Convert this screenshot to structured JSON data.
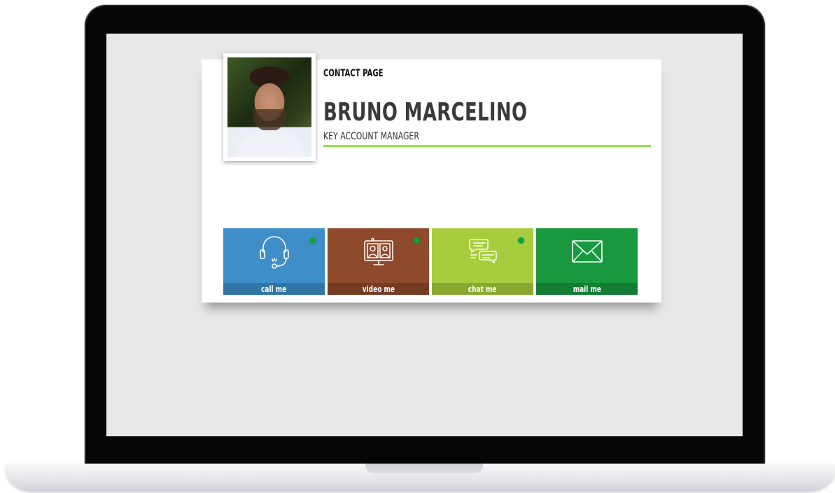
{
  "page": {
    "kicker": "CONTACT PAGE",
    "name": "BRUNO MARCELINO",
    "role": "KEY ACCOUNT MANAGER"
  },
  "contact_options": [
    {
      "label": "call me",
      "icon": "headset-icon",
      "color": "#3e8ec9",
      "online": true
    },
    {
      "label": "video me",
      "icon": "video-call-icon",
      "color": "#8f4a2c",
      "online": true
    },
    {
      "label": "chat me",
      "icon": "chat-bubbles-icon",
      "color": "#a7cd3e",
      "online": true
    },
    {
      "label": "mail me",
      "icon": "envelope-icon",
      "color": "#18993f",
      "online": false
    }
  ],
  "colors": {
    "accent": "#8fe24a",
    "status_online": "#0fa33a"
  }
}
